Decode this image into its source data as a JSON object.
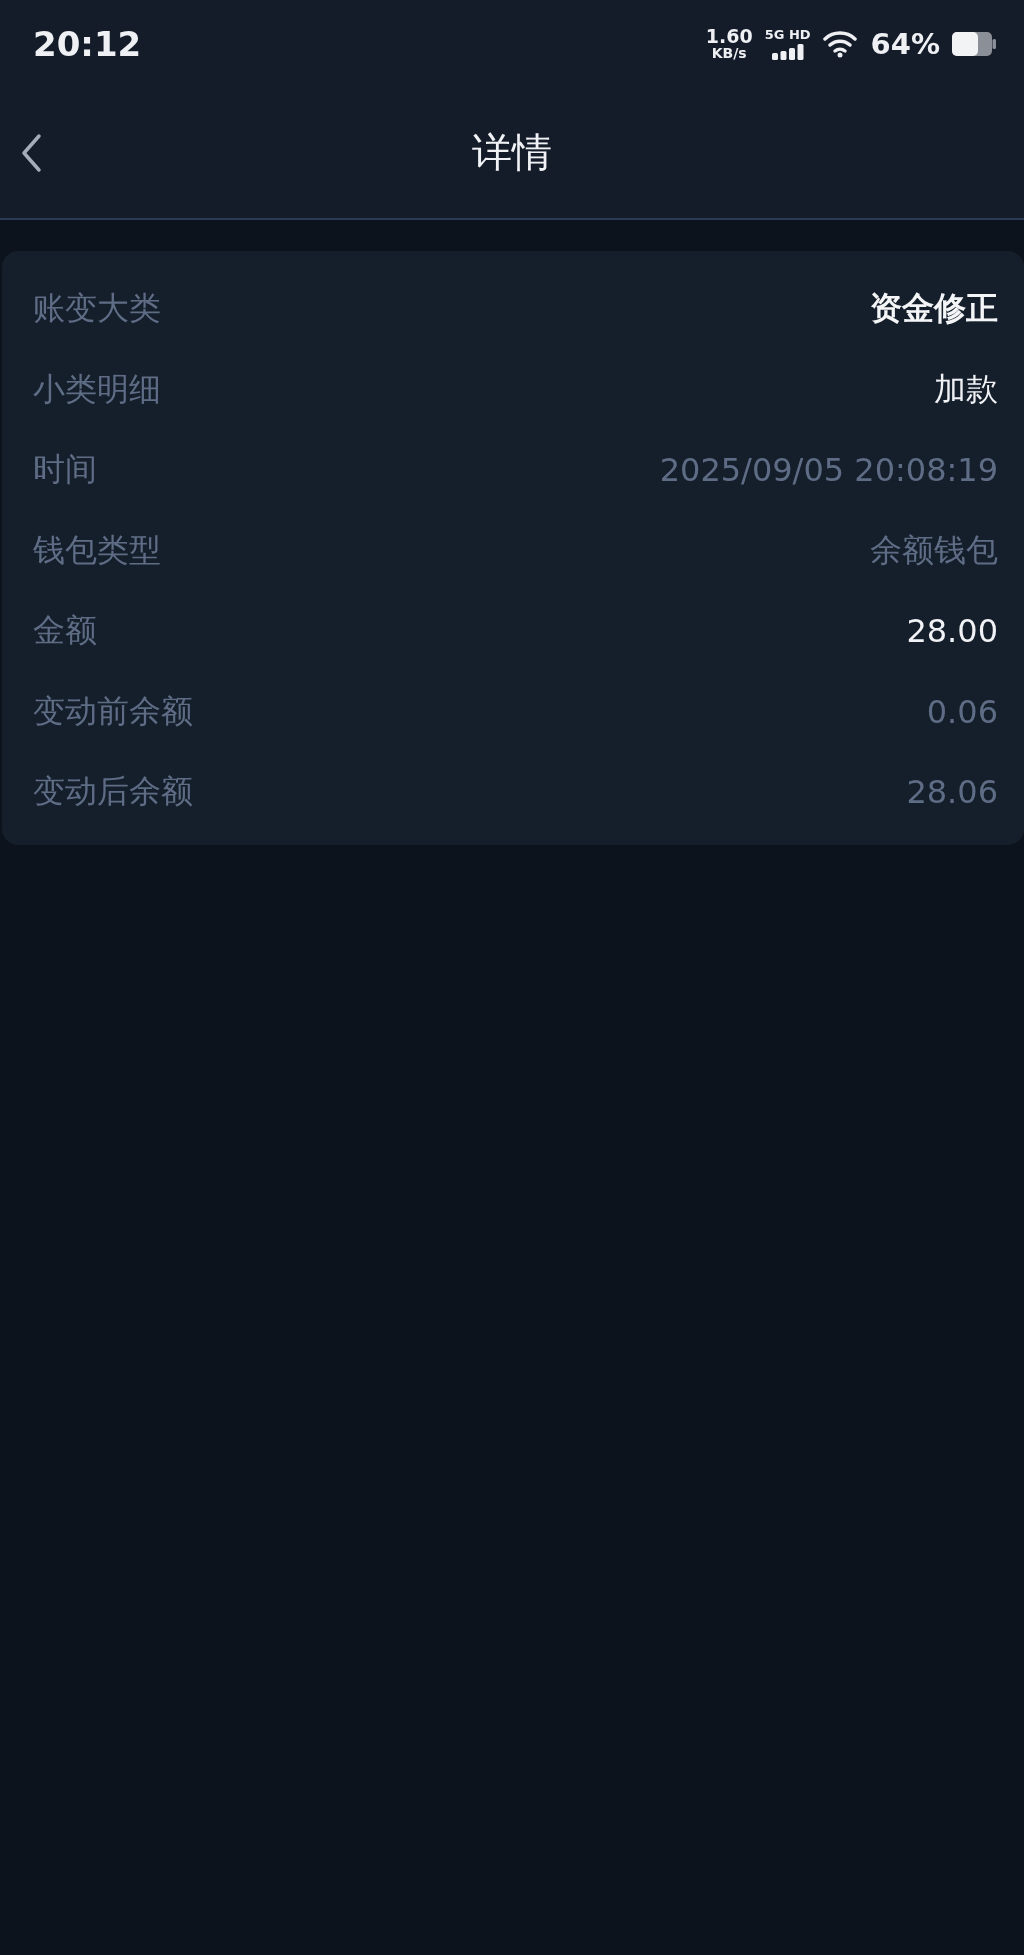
{
  "status_bar": {
    "time": "20:12",
    "speed_value": "1.60",
    "speed_unit": "KB/s",
    "network": "5G HD",
    "battery": "64%"
  },
  "header": {
    "title": "详情"
  },
  "details": [
    {
      "label": "账变大类",
      "value": "资金修正",
      "kind": "bold"
    },
    {
      "label": "小类明细",
      "value": "加款",
      "kind": "bright"
    },
    {
      "label": "时间",
      "value": "2025/09/05 20:08:19",
      "kind": "muted"
    },
    {
      "label": "钱包类型",
      "value": "余额钱包",
      "kind": "muted"
    },
    {
      "label": "金额",
      "value": "28.00",
      "kind": "bright"
    },
    {
      "label": "变动前余额",
      "value": "0.06",
      "kind": "muted"
    },
    {
      "label": "变动后余额",
      "value": "28.06",
      "kind": "muted"
    }
  ]
}
